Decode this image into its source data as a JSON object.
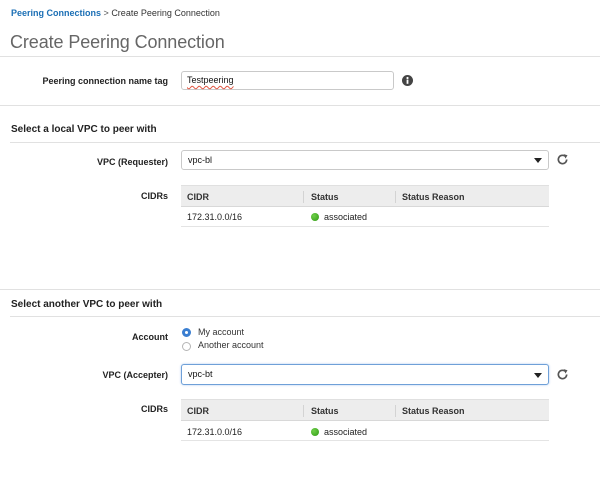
{
  "breadcrumb": {
    "parent": "Peering Connections",
    "separator": ">",
    "current": "Create Peering Connection"
  },
  "page": {
    "title": "Create Peering Connection"
  },
  "name_tag": {
    "label": "Peering connection name tag",
    "value": "Testpeering",
    "info_icon": "info-icon"
  },
  "local_vpc": {
    "section_title": "Select a local VPC to peer with",
    "vpc_label": "VPC (Requester)",
    "vpc_value": "vpc-bl",
    "cidrs_label": "CIDRs",
    "columns": [
      "CIDR",
      "Status",
      "Status Reason"
    ],
    "rows": [
      {
        "cidr": "172.31.0.0/16",
        "status": "associated",
        "reason": ""
      }
    ]
  },
  "another_vpc": {
    "section_title": "Select another VPC to peer with",
    "account_label": "Account",
    "account_options": [
      {
        "label": "My account",
        "selected": true
      },
      {
        "label": "Another account",
        "selected": false
      }
    ],
    "vpc_label": "VPC (Accepter)",
    "vpc_value": "vpc-bt",
    "cidrs_label": "CIDRs",
    "columns": [
      "CIDR",
      "Status",
      "Status Reason"
    ],
    "rows": [
      {
        "cidr": "172.31.0.0/16",
        "status": "associated",
        "reason": ""
      }
    ]
  },
  "colors": {
    "link": "#1b6fb5",
    "status_ok": "#3aa81a",
    "radio_selected": "#3b7fd1",
    "focus_border": "#6fa0d8"
  },
  "icons": {
    "refresh": "refresh-icon",
    "dropdown": "chevron-down-icon",
    "info": "info-icon",
    "status": "status-dot-icon"
  }
}
